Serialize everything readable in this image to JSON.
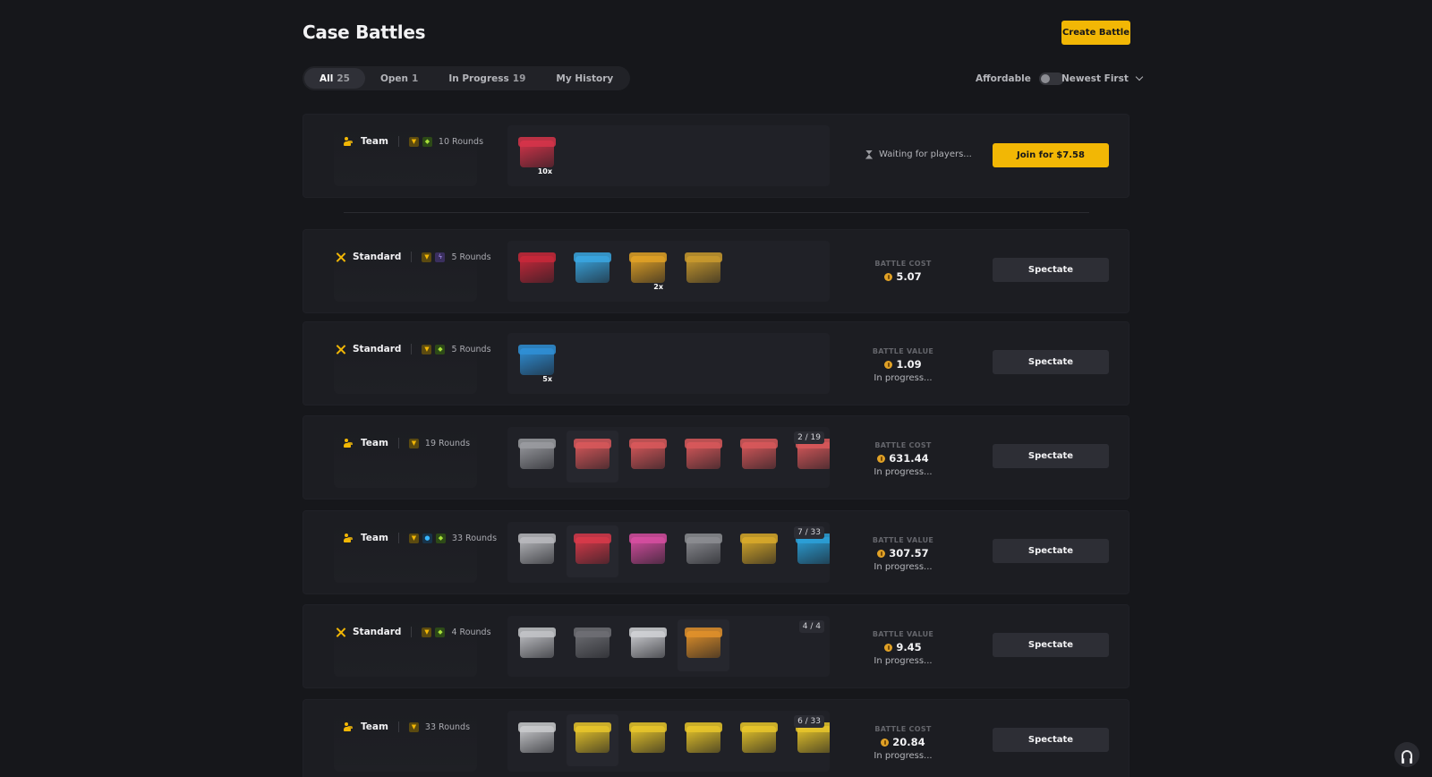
{
  "header": {
    "title": "Case Battles",
    "create_label": "Create Battle"
  },
  "tabs": [
    {
      "label": "All",
      "count": "25",
      "active": true
    },
    {
      "label": "Open",
      "count": "1",
      "active": false
    },
    {
      "label": "In Progress",
      "count": "19",
      "active": false
    },
    {
      "label": "My History",
      "count": "",
      "active": false
    }
  ],
  "filters": {
    "affordable_label": "Affordable",
    "affordable_on": false,
    "sort_label": "Newest First"
  },
  "battles": [
    {
      "mode": "Team",
      "mode_icon": "team-icon",
      "badges": [
        "trophy-icon",
        "tag-icon"
      ],
      "rounds": "10 Rounds",
      "cases": [
        {
          "color": "#d6344a",
          "mult": "10x"
        }
      ],
      "counter": "",
      "status_kind": "waiting",
      "status_text": "Waiting for players...",
      "action": "Join for $7.58",
      "action_kind": "join"
    },
    {
      "mode": "Standard",
      "mode_icon": "swords-icon",
      "badges": [
        "trophy-icon",
        "bolt-icon"
      ],
      "rounds": "5 Rounds",
      "cases": [
        {
          "color": "#c8283a"
        },
        {
          "color": "#3aa6e0"
        },
        {
          "color": "#e0a126",
          "mult": "2x"
        },
        {
          "color": "#c99a2e"
        }
      ],
      "counter": "",
      "status_kind": "value",
      "status_label": "BATTLE COST",
      "status_value": "5.07",
      "status_sub": "",
      "action": "Spectate",
      "action_kind": "spectate"
    },
    {
      "mode": "Standard",
      "mode_icon": "swords-icon",
      "badges": [
        "trophy-icon",
        "tag-icon"
      ],
      "rounds": "5 Rounds",
      "cases": [
        {
          "color": "#2f8fd6",
          "mult": "5x"
        }
      ],
      "counter": "",
      "status_kind": "value",
      "status_label": "BATTLE VALUE",
      "status_value": "1.09",
      "status_sub": "In progress...",
      "action": "Spectate",
      "action_kind": "spectate"
    },
    {
      "mode": "Team",
      "mode_icon": "team-icon",
      "badges": [
        "trophy-icon"
      ],
      "rounds": "19 Rounds",
      "cases": [
        {
          "color": "#9a9ba0"
        },
        {
          "color": "#d8585a",
          "hl": true
        },
        {
          "color": "#d8585a"
        },
        {
          "color": "#d8585a"
        },
        {
          "color": "#d8585a"
        },
        {
          "color": "#d8585a"
        }
      ],
      "counter": "2 / 19",
      "status_kind": "value",
      "status_label": "BATTLE COST",
      "status_value": "631.44",
      "status_sub": "In progress...",
      "action": "Spectate",
      "action_kind": "spectate"
    },
    {
      "mode": "Team",
      "mode_icon": "team-icon",
      "badges": [
        "trophy-icon",
        "drop-icon",
        "tag-icon"
      ],
      "rounds": "33 Rounds",
      "cases": [
        {
          "color": "#b8b9bd"
        },
        {
          "color": "#d83a4a",
          "hl": true
        },
        {
          "color": "#d64ea0"
        },
        {
          "color": "#8c8d92"
        },
        {
          "color": "#d8a92a"
        },
        {
          "color": "#2ba0d8"
        }
      ],
      "counter": "7 / 33",
      "status_kind": "value",
      "status_label": "BATTLE VALUE",
      "status_value": "307.57",
      "status_sub": "In progress...",
      "action": "Spectate",
      "action_kind": "spectate"
    },
    {
      "mode": "Standard",
      "mode_icon": "swords-icon",
      "badges": [
        "trophy-icon",
        "tag-icon"
      ],
      "rounds": "4 Rounds",
      "cases": [
        {
          "color": "#c2c3c7"
        },
        {
          "color": "#6e6f74"
        },
        {
          "color": "#d0d1d5"
        },
        {
          "color": "#e0902a",
          "hl": true
        }
      ],
      "counter": "4 / 4",
      "status_kind": "value",
      "status_label": "BATTLE VALUE",
      "status_value": "9.45",
      "status_sub": "In progress...",
      "action": "Spectate",
      "action_kind": "spectate"
    },
    {
      "mode": "Team",
      "mode_icon": "team-icon",
      "badges": [
        "trophy-icon"
      ],
      "rounds": "33 Rounds",
      "cases": [
        {
          "color": "#c9cacd"
        },
        {
          "color": "#e8c62a",
          "hl": true
        },
        {
          "color": "#e8c62a"
        },
        {
          "color": "#e8c62a"
        },
        {
          "color": "#e8c62a"
        },
        {
          "color": "#e8c62a"
        }
      ],
      "counter": "6 / 33",
      "status_kind": "value",
      "status_label": "BATTLE COST",
      "status_value": "20.84",
      "status_sub": "In progress...",
      "action": "Spectate",
      "action_kind": "spectate"
    }
  ],
  "support": {
    "icon": "headset-icon"
  }
}
